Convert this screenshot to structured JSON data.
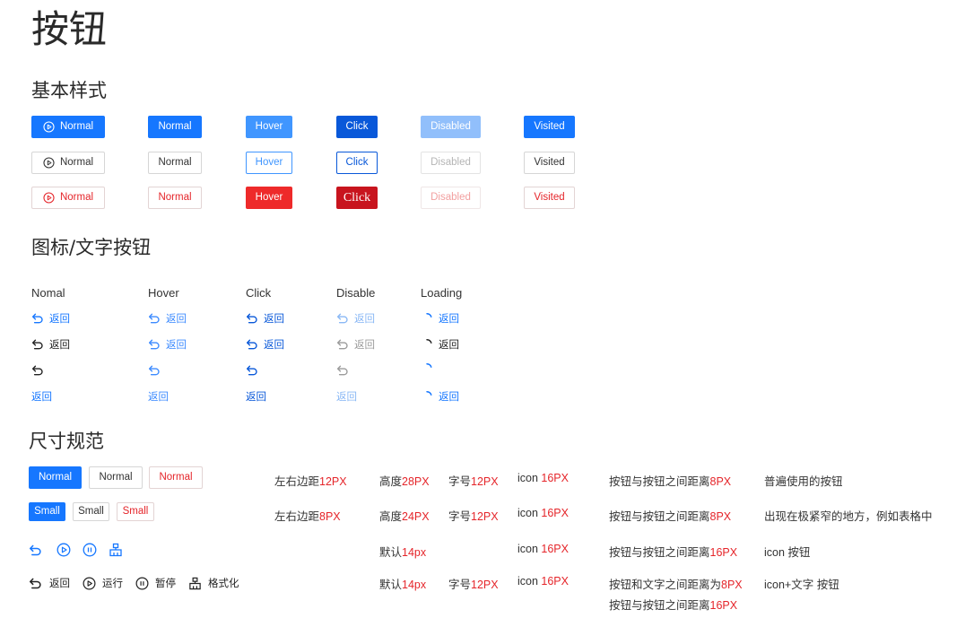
{
  "page_title": "按钮",
  "sections": {
    "basic": "基本样式",
    "icon_text": "图标/文字按钮",
    "size": "尺寸规范"
  },
  "basic": {
    "row1": [
      "Normal",
      "Normal",
      "Hover",
      "Click",
      "Disabled",
      "Visited"
    ],
    "row2": [
      "Normal",
      "Normal",
      "Hover",
      "Click",
      "Disabled",
      "Visited"
    ],
    "row3": [
      "Normal",
      "Normal",
      "Hover",
      "Click",
      "Disabled",
      "Visited"
    ]
  },
  "icon_text": {
    "headers": [
      "Nomal",
      "Hover",
      "Click",
      "Disable",
      "Loading"
    ],
    "label": "返回"
  },
  "size": {
    "normal_buttons": [
      "Normal",
      "Normal",
      "Normal"
    ],
    "small_buttons": [
      "Small",
      "Small",
      "Small"
    ],
    "icon_text_buttons": [
      "返回",
      "运行",
      "暂停",
      "格式化"
    ],
    "rows": [
      {
        "padding_label": "左右边距",
        "padding_value": "12PX",
        "height_label": "高度",
        "height_value": "28PX",
        "font_label": "字号",
        "font_value": "12PX",
        "icon_label": "icon ",
        "icon_value": "16PX",
        "gap_label": "按钮与按钮之间距离",
        "gap_value": "8PX",
        "usage": "普遍使用的按钮"
      },
      {
        "padding_label": "左右边距",
        "padding_value": "8PX",
        "height_label": "高度",
        "height_value": "24PX",
        "font_label": "字号",
        "font_value": "12PX",
        "icon_label": "icon ",
        "icon_value": "16PX",
        "gap_label": "按钮与按钮之间距离",
        "gap_value": "8PX",
        "usage": "出现在极紧窄的地方，例如表格中"
      },
      {
        "height_label": "默认",
        "height_value": "14px",
        "icon_label": "icon ",
        "icon_value": "16PX",
        "gap_label": "按钮与按钮之间距离",
        "gap_value": "16PX",
        "usage": "icon 按钮"
      },
      {
        "height_label": "默认",
        "height_value": "14px",
        "font_label": "字号",
        "font_value": "12PX",
        "icon_label": "icon ",
        "icon_value": "16PX",
        "gap_label": "按钮和文字之间距离为",
        "gap_value": "8PX",
        "gap2_label": "按钮与按钮之间距离",
        "gap2_value": "16PX",
        "usage": "icon+文字 按钮"
      }
    ]
  },
  "colors": {
    "primary": "#1677ff",
    "primary_hover": "#4096ff",
    "primary_click": "#0958d9",
    "primary_disabled": "#91bffb",
    "danger": "#e5252a",
    "danger_click": "#c8141e"
  }
}
